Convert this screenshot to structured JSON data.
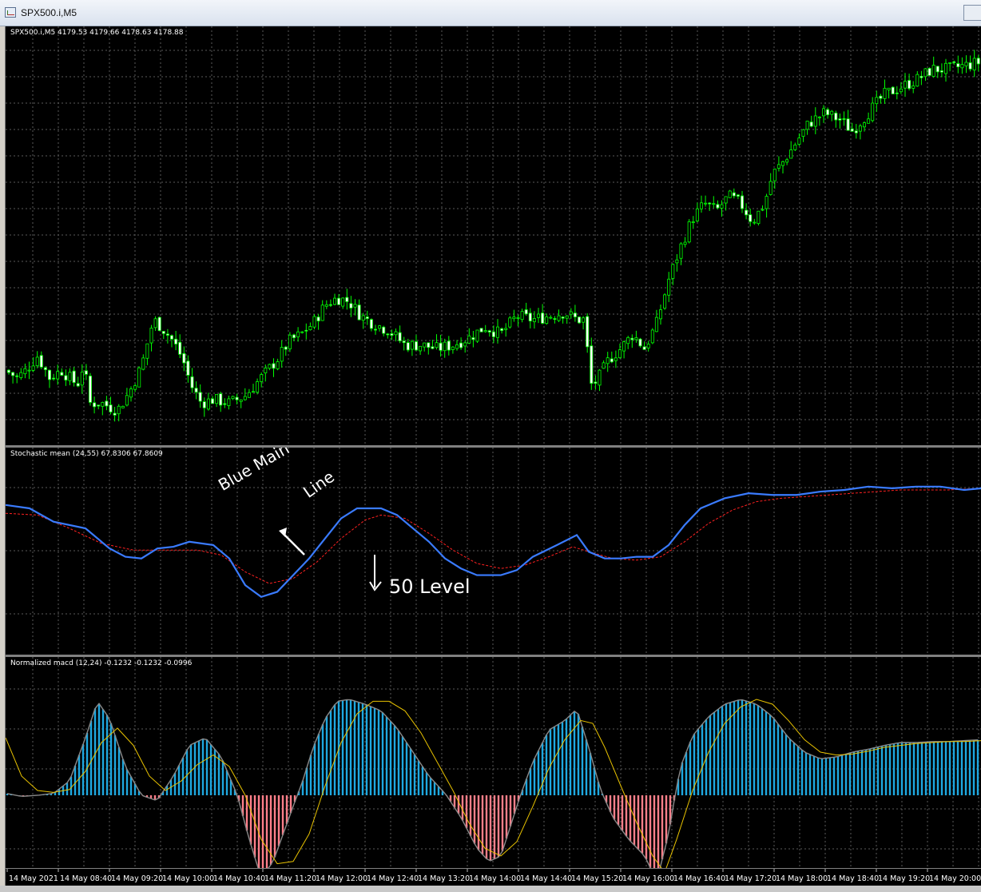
{
  "window": {
    "title": "SPX500.i,M5"
  },
  "panes": {
    "price_label": "SPX500.i,M5  4179.53 4179.66 4178.63 4178.88",
    "stoch_label": "Stochastic mean (24,55) 67.8306 67.8609",
    "macd_label": "Normalized macd (12,24) -0.1232 -0.1232 -0.0996"
  },
  "annotations": {
    "blue_main": "Blue Main",
    "line": "Line",
    "level": "50 Level"
  },
  "colors": {
    "bull_candle": "#00ff00",
    "stoch_main": "#3a7bff",
    "stoch_signal": "#ff2020",
    "macd_pos": "#1ea8e0",
    "macd_neg": "#ff7f8a",
    "macd_signal": "#e8c200",
    "grid": "#5a5a5a"
  },
  "chart_data": [
    {
      "type": "candlestick",
      "title": "SPX500.i,M5  4179.53 4179.66 4178.63 4178.88",
      "close_path": [
        [
          0,
          0.14
        ],
        [
          15,
          0.12
        ],
        [
          25,
          0.14
        ],
        [
          40,
          0.18
        ],
        [
          55,
          0.12
        ],
        [
          70,
          0.14
        ],
        [
          90,
          0.1
        ],
        [
          98,
          0.16
        ],
        [
          105,
          0.05
        ],
        [
          120,
          0.05
        ],
        [
          140,
          0.03
        ],
        [
          155,
          0.08
        ],
        [
          170,
          0.15
        ],
        [
          185,
          0.28
        ],
        [
          195,
          0.26
        ],
        [
          210,
          0.22
        ],
        [
          222,
          0.17
        ],
        [
          232,
          0.1
        ],
        [
          245,
          0.05
        ],
        [
          260,
          0.06
        ],
        [
          280,
          0.05
        ],
        [
          300,
          0.07
        ],
        [
          320,
          0.12
        ],
        [
          340,
          0.17
        ],
        [
          355,
          0.22
        ],
        [
          370,
          0.24
        ],
        [
          385,
          0.27
        ],
        [
          400,
          0.32
        ],
        [
          415,
          0.34
        ],
        [
          430,
          0.33
        ],
        [
          445,
          0.29
        ],
        [
          460,
          0.27
        ],
        [
          480,
          0.25
        ],
        [
          500,
          0.21
        ],
        [
          520,
          0.21
        ],
        [
          540,
          0.2
        ],
        [
          560,
          0.21
        ],
        [
          580,
          0.23
        ],
        [
          600,
          0.26
        ],
        [
          620,
          0.24
        ],
        [
          640,
          0.29
        ],
        [
          660,
          0.28
        ],
        [
          680,
          0.29
        ],
        [
          700,
          0.3
        ],
        [
          715,
          0.28
        ],
        [
          725,
          0.28
        ],
        [
          732,
          0.1
        ],
        [
          740,
          0.11
        ],
        [
          755,
          0.17
        ],
        [
          770,
          0.2
        ],
        [
          785,
          0.24
        ],
        [
          800,
          0.2
        ],
        [
          815,
          0.27
        ],
        [
          830,
          0.39
        ],
        [
          845,
          0.48
        ],
        [
          860,
          0.56
        ],
        [
          875,
          0.6
        ],
        [
          890,
          0.58
        ],
        [
          905,
          0.62
        ],
        [
          920,
          0.6
        ],
        [
          935,
          0.55
        ],
        [
          950,
          0.6
        ],
        [
          960,
          0.68
        ],
        [
          975,
          0.72
        ],
        [
          990,
          0.77
        ],
        [
          1005,
          0.82
        ],
        [
          1025,
          0.85
        ],
        [
          1045,
          0.83
        ],
        [
          1060,
          0.8
        ],
        [
          1080,
          0.85
        ],
        [
          1100,
          0.9
        ],
        [
          1120,
          0.92
        ],
        [
          1140,
          0.94
        ],
        [
          1160,
          0.97
        ],
        [
          1180,
          0.97
        ],
        [
          1200,
          0.98
        ],
        [
          1222,
          0.99
        ]
      ]
    },
    {
      "type": "line",
      "title": "Stochastic mean (24,55) 67.8306 67.8609",
      "series": [
        {
          "values": [
            [
              0,
              0.8
            ],
            [
              30,
              0.78
            ],
            [
              60,
              0.7
            ],
            [
              100,
              0.66
            ],
            [
              130,
              0.54
            ],
            [
              150,
              0.49
            ],
            [
              170,
              0.48
            ],
            [
              190,
              0.54
            ],
            [
              210,
              0.55
            ],
            [
              230,
              0.58
            ],
            [
              260,
              0.56
            ],
            [
              280,
              0.48
            ],
            [
              300,
              0.32
            ],
            [
              320,
              0.25
            ],
            [
              340,
              0.28
            ],
            [
              360,
              0.38
            ],
            [
              380,
              0.48
            ],
            [
              400,
              0.6
            ],
            [
              420,
              0.72
            ],
            [
              440,
              0.78
            ],
            [
              470,
              0.78
            ],
            [
              490,
              0.74
            ],
            [
              510,
              0.66
            ],
            [
              530,
              0.58
            ],
            [
              550,
              0.48
            ],
            [
              570,
              0.42
            ],
            [
              590,
              0.38
            ],
            [
              620,
              0.38
            ],
            [
              640,
              0.41
            ],
            [
              660,
              0.49
            ],
            [
              690,
              0.56
            ],
            [
              715,
              0.62
            ],
            [
              730,
              0.52
            ],
            [
              750,
              0.48
            ],
            [
              770,
              0.48
            ],
            [
              790,
              0.49
            ],
            [
              810,
              0.49
            ],
            [
              830,
              0.56
            ],
            [
              850,
              0.68
            ],
            [
              870,
              0.78
            ],
            [
              900,
              0.84
            ],
            [
              930,
              0.87
            ],
            [
              960,
              0.86
            ],
            [
              990,
              0.86
            ],
            [
              1020,
              0.88
            ],
            [
              1050,
              0.89
            ],
            [
              1080,
              0.91
            ],
            [
              1110,
              0.9
            ],
            [
              1140,
              0.91
            ],
            [
              1170,
              0.91
            ],
            [
              1200,
              0.89
            ],
            [
              1222,
              0.9
            ]
          ]
        },
        {
          "values": [
            [
              0,
              0.75
            ],
            [
              40,
              0.74
            ],
            [
              80,
              0.66
            ],
            [
              120,
              0.57
            ],
            [
              160,
              0.53
            ],
            [
              200,
              0.53
            ],
            [
              240,
              0.53
            ],
            [
              270,
              0.5
            ],
            [
              300,
              0.4
            ],
            [
              330,
              0.33
            ],
            [
              360,
              0.36
            ],
            [
              390,
              0.46
            ],
            [
              420,
              0.6
            ],
            [
              450,
              0.71
            ],
            [
              470,
              0.74
            ],
            [
              500,
              0.72
            ],
            [
              530,
              0.63
            ],
            [
              560,
              0.53
            ],
            [
              590,
              0.45
            ],
            [
              620,
              0.42
            ],
            [
              650,
              0.44
            ],
            [
              680,
              0.49
            ],
            [
              710,
              0.55
            ],
            [
              730,
              0.52
            ],
            [
              760,
              0.48
            ],
            [
              790,
              0.47
            ],
            [
              820,
              0.49
            ],
            [
              850,
              0.58
            ],
            [
              880,
              0.69
            ],
            [
              910,
              0.77
            ],
            [
              940,
              0.82
            ],
            [
              970,
              0.84
            ],
            [
              1000,
              0.85
            ],
            [
              1030,
              0.86
            ],
            [
              1060,
              0.87
            ],
            [
              1090,
              0.88
            ],
            [
              1120,
              0.89
            ],
            [
              1150,
              0.89
            ],
            [
              1180,
              0.89
            ],
            [
              1222,
              0.9
            ]
          ]
        }
      ]
    },
    {
      "type": "bar",
      "title": "Normalized macd (12,24) -0.1232 -0.1232 -0.0996",
      "histogram": [
        [
          0,
          0.02
        ],
        [
          20,
          -0.01
        ],
        [
          40,
          0.0
        ],
        [
          60,
          0.02
        ],
        [
          80,
          0.15
        ],
        [
          100,
          0.6
        ],
        [
          115,
          0.98
        ],
        [
          130,
          0.8
        ],
        [
          150,
          0.3
        ],
        [
          170,
          0.0
        ],
        [
          190,
          -0.05
        ],
        [
          210,
          0.2
        ],
        [
          230,
          0.52
        ],
        [
          250,
          0.6
        ],
        [
          270,
          0.4
        ],
        [
          290,
          0.0
        ],
        [
          305,
          -0.4
        ],
        [
          320,
          -0.75
        ],
        [
          335,
          -0.6
        ],
        [
          355,
          -0.2
        ],
        [
          370,
          0.1
        ],
        [
          385,
          0.5
        ],
        [
          400,
          0.8
        ],
        [
          415,
          0.98
        ],
        [
          430,
          1.0
        ],
        [
          450,
          0.95
        ],
        [
          470,
          0.88
        ],
        [
          490,
          0.7
        ],
        [
          510,
          0.45
        ],
        [
          530,
          0.2
        ],
        [
          550,
          0.02
        ],
        [
          570,
          -0.2
        ],
        [
          590,
          -0.48
        ],
        [
          605,
          -0.6
        ],
        [
          620,
          -0.55
        ],
        [
          640,
          -0.1
        ],
        [
          660,
          0.35
        ],
        [
          680,
          0.68
        ],
        [
          700,
          0.78
        ],
        [
          715,
          0.9
        ],
        [
          730,
          0.5
        ],
        [
          745,
          0.05
        ],
        [
          760,
          -0.2
        ],
        [
          780,
          -0.4
        ],
        [
          800,
          -0.55
        ],
        [
          815,
          -0.78
        ],
        [
          830,
          -0.35
        ],
        [
          845,
          0.3
        ],
        [
          860,
          0.62
        ],
        [
          880,
          0.82
        ],
        [
          900,
          0.95
        ],
        [
          920,
          1.0
        ],
        [
          940,
          0.95
        ],
        [
          960,
          0.82
        ],
        [
          980,
          0.6
        ],
        [
          1000,
          0.45
        ],
        [
          1020,
          0.38
        ],
        [
          1040,
          0.4
        ],
        [
          1060,
          0.45
        ],
        [
          1080,
          0.48
        ],
        [
          1100,
          0.52
        ],
        [
          1120,
          0.55
        ],
        [
          1140,
          0.55
        ],
        [
          1160,
          0.56
        ],
        [
          1180,
          0.56
        ],
        [
          1200,
          0.57
        ],
        [
          1222,
          0.58
        ]
      ],
      "signal": [
        [
          0,
          0.6
        ],
        [
          20,
          0.2
        ],
        [
          40,
          0.05
        ],
        [
          60,
          0.03
        ],
        [
          80,
          0.06
        ],
        [
          100,
          0.25
        ],
        [
          120,
          0.55
        ],
        [
          140,
          0.7
        ],
        [
          160,
          0.52
        ],
        [
          180,
          0.2
        ],
        [
          200,
          0.05
        ],
        [
          220,
          0.15
        ],
        [
          240,
          0.32
        ],
        [
          260,
          0.42
        ],
        [
          280,
          0.3
        ],
        [
          300,
          0.0
        ],
        [
          320,
          -0.4
        ],
        [
          340,
          -0.62
        ],
        [
          360,
          -0.6
        ],
        [
          380,
          -0.35
        ],
        [
          400,
          0.1
        ],
        [
          420,
          0.55
        ],
        [
          440,
          0.85
        ],
        [
          460,
          0.98
        ],
        [
          480,
          0.98
        ],
        [
          500,
          0.88
        ],
        [
          520,
          0.65
        ],
        [
          540,
          0.35
        ],
        [
          560,
          0.05
        ],
        [
          580,
          -0.25
        ],
        [
          600,
          -0.48
        ],
        [
          620,
          -0.55
        ],
        [
          640,
          -0.42
        ],
        [
          660,
          -0.1
        ],
        [
          680,
          0.28
        ],
        [
          700,
          0.58
        ],
        [
          720,
          0.78
        ],
        [
          735,
          0.75
        ],
        [
          750,
          0.5
        ],
        [
          770,
          0.1
        ],
        [
          790,
          -0.25
        ],
        [
          810,
          -0.55
        ],
        [
          825,
          -0.7
        ],
        [
          840,
          -0.4
        ],
        [
          860,
          0.05
        ],
        [
          880,
          0.45
        ],
        [
          900,
          0.75
        ],
        [
          920,
          0.92
        ],
        [
          940,
          1.0
        ],
        [
          960,
          0.95
        ],
        [
          980,
          0.78
        ],
        [
          1000,
          0.58
        ],
        [
          1020,
          0.45
        ],
        [
          1040,
          0.42
        ],
        [
          1060,
          0.43
        ],
        [
          1080,
          0.46
        ],
        [
          1100,
          0.5
        ],
        [
          1120,
          0.52
        ],
        [
          1140,
          0.54
        ],
        [
          1160,
          0.55
        ],
        [
          1180,
          0.56
        ],
        [
          1200,
          0.56
        ],
        [
          1222,
          0.57
        ]
      ]
    }
  ],
  "xaxis": {
    "ticks": [
      "14 May 2021",
      "14 May 08:40",
      "14 May 09:20",
      "14 May 10:00",
      "14 May 10:40",
      "14 May 11:20",
      "14 May 12:00",
      "14 May 12:40",
      "14 May 13:20",
      "14 May 14:00",
      "14 May 14:40",
      "14 May 15:20",
      "14 May 16:00",
      "14 May 16:40",
      "14 May 17:20",
      "14 May 18:00",
      "14 May 18:40",
      "14 May 19:20",
      "14 May 20:00"
    ]
  }
}
